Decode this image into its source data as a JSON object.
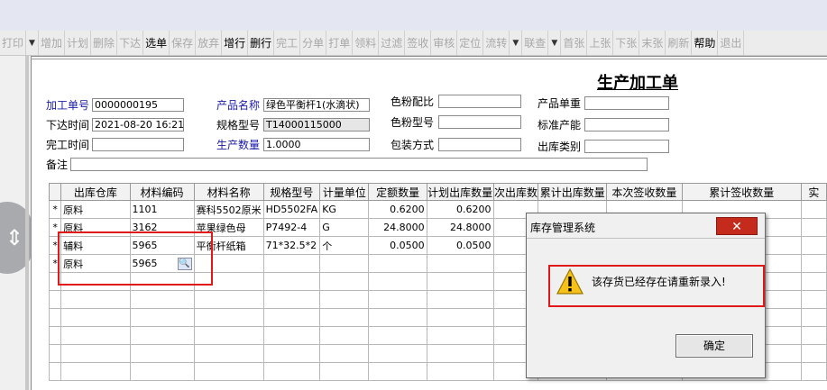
{
  "toolbar": {
    "items": [
      {
        "label": "打印",
        "on": false
      },
      {
        "label": "▼",
        "on": true,
        "drop": true
      },
      {
        "label": "增加",
        "on": false
      },
      {
        "label": "计划",
        "on": false
      },
      {
        "label": "删除",
        "on": false
      },
      {
        "label": "下达",
        "on": false
      },
      {
        "label": "选单",
        "on": true
      },
      {
        "label": "保存",
        "on": false
      },
      {
        "label": "放弃",
        "on": false
      },
      {
        "label": "增行",
        "on": true
      },
      {
        "label": "删行",
        "on": true
      },
      {
        "label": "完工",
        "on": false
      },
      {
        "label": "分单",
        "on": false
      },
      {
        "label": "打单",
        "on": false
      },
      {
        "label": "领料",
        "on": false
      },
      {
        "label": "过滤",
        "on": false
      },
      {
        "label": "签收",
        "on": false
      },
      {
        "label": "审核",
        "on": false
      },
      {
        "label": "定位",
        "on": false
      },
      {
        "label": "流转",
        "on": false
      },
      {
        "label": "▼",
        "on": true,
        "drop": true
      },
      {
        "label": "联查",
        "on": false
      },
      {
        "label": "▼",
        "on": true,
        "drop": true
      },
      {
        "label": "首张",
        "on": false
      },
      {
        "label": "上张",
        "on": false
      },
      {
        "label": "下张",
        "on": false
      },
      {
        "label": "末张",
        "on": false
      },
      {
        "label": "刷新",
        "on": false
      },
      {
        "label": "帮助",
        "on": true
      },
      {
        "label": "退出",
        "on": false
      }
    ]
  },
  "form": {
    "title": "生产加工单",
    "order_no_label": "加工单号",
    "order_no": "0000000195",
    "issue_time_label": "下达时间",
    "issue_time": "2021-08-20 16:21",
    "finish_time_label": "完工时间",
    "finish_time": "",
    "product_name_label": "产品名称",
    "product_name": "绿色平衡杆1(水滴状)",
    "spec_label": "规格型号",
    "spec": "T14000115000",
    "qty_label": "生产数量",
    "qty": "1.0000",
    "color_ratio_label": "色粉配比",
    "color_ratio": "",
    "color_model_label": "色粉型号",
    "color_model": "",
    "pack_label": "包装方式",
    "pack": "",
    "unit_weight_label": "产品单重",
    "unit_weight": "",
    "std_capacity_label": "标准产能",
    "std_capacity": "",
    "outbound_type_label": "出库类别",
    "outbound_type": "",
    "remark_label": "备注",
    "remark": ""
  },
  "grid": {
    "columns": [
      "出库仓库",
      "材料编码",
      "材料名称",
      "规格型号",
      "计量单位",
      "定额数量",
      "计划出库数量",
      "次出库数",
      "累计出库数量",
      "本次签收数量",
      "累计签收数量",
      "实"
    ],
    "rows": [
      {
        "mark": "*",
        "warehouse": "原料",
        "code": "1101",
        "name": "赛科5502原米",
        "spec": "HD5502FA",
        "unit": "KG",
        "quota": "0.6200",
        "plan": "0.6200"
      },
      {
        "mark": "*",
        "warehouse": "原料",
        "code": "3162",
        "name": "苹果绿色母",
        "spec": "P7492-4",
        "unit": "G",
        "quota": "24.8000",
        "plan": "24.8000"
      },
      {
        "mark": "*",
        "warehouse": "辅料",
        "code": "5965",
        "name": "平衡杆纸箱",
        "spec": "71*32.5*2",
        "unit": "个",
        "quota": "0.0500",
        "plan": "0.0500"
      },
      {
        "mark": "*",
        "warehouse": "原料",
        "code": "5965",
        "name": "",
        "spec": "",
        "unit": "",
        "quota": "",
        "plan": ""
      }
    ]
  },
  "dialog": {
    "title": "库存管理系统",
    "message": "该存货已经存在请重新录入!",
    "ok_label": "确定",
    "close_glyph": "✕"
  },
  "colors": {
    "accent_red": "#e01818",
    "label_blue": "#1a1aa8",
    "close_red": "#c42b1c"
  },
  "icons": [
    "magnifier-icon",
    "warning-icon",
    "close-icon"
  ]
}
